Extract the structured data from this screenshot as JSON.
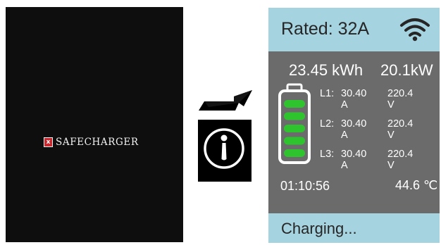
{
  "boot_screen": {
    "logo_mark": "x",
    "brand_name": "SAFECHARGER",
    "colors": {
      "background": "#0e0e0e",
      "logo_mark": "#c8282d"
    }
  },
  "transition": {
    "arrow_icon": "right-arrow-icon",
    "info_icon": "info-icon"
  },
  "charging_screen": {
    "header": {
      "rated": "Rated: 32A",
      "wifi_icon": "wifi-icon"
    },
    "energy": "23.45 kWh",
    "power": "20.1kW",
    "battery": {
      "icon": "battery-icon",
      "filled_bars": 5,
      "total_bars": 5
    },
    "phases": [
      {
        "label": "L1:",
        "current": "30.40 A",
        "voltage": "220.4 V"
      },
      {
        "label": "L2:",
        "current": "30.40 A",
        "voltage": "220.4 V"
      },
      {
        "label": "L3:",
        "current": "30.40 A",
        "voltage": "220.4 V"
      }
    ],
    "elapsed_time": "01:10:56",
    "temperature": "44.6 ℃",
    "status": "Charging...",
    "colors": {
      "bars": "#a6d3e0",
      "panel": "#6b6b6b",
      "battery_fill": "#2ec42e"
    }
  }
}
